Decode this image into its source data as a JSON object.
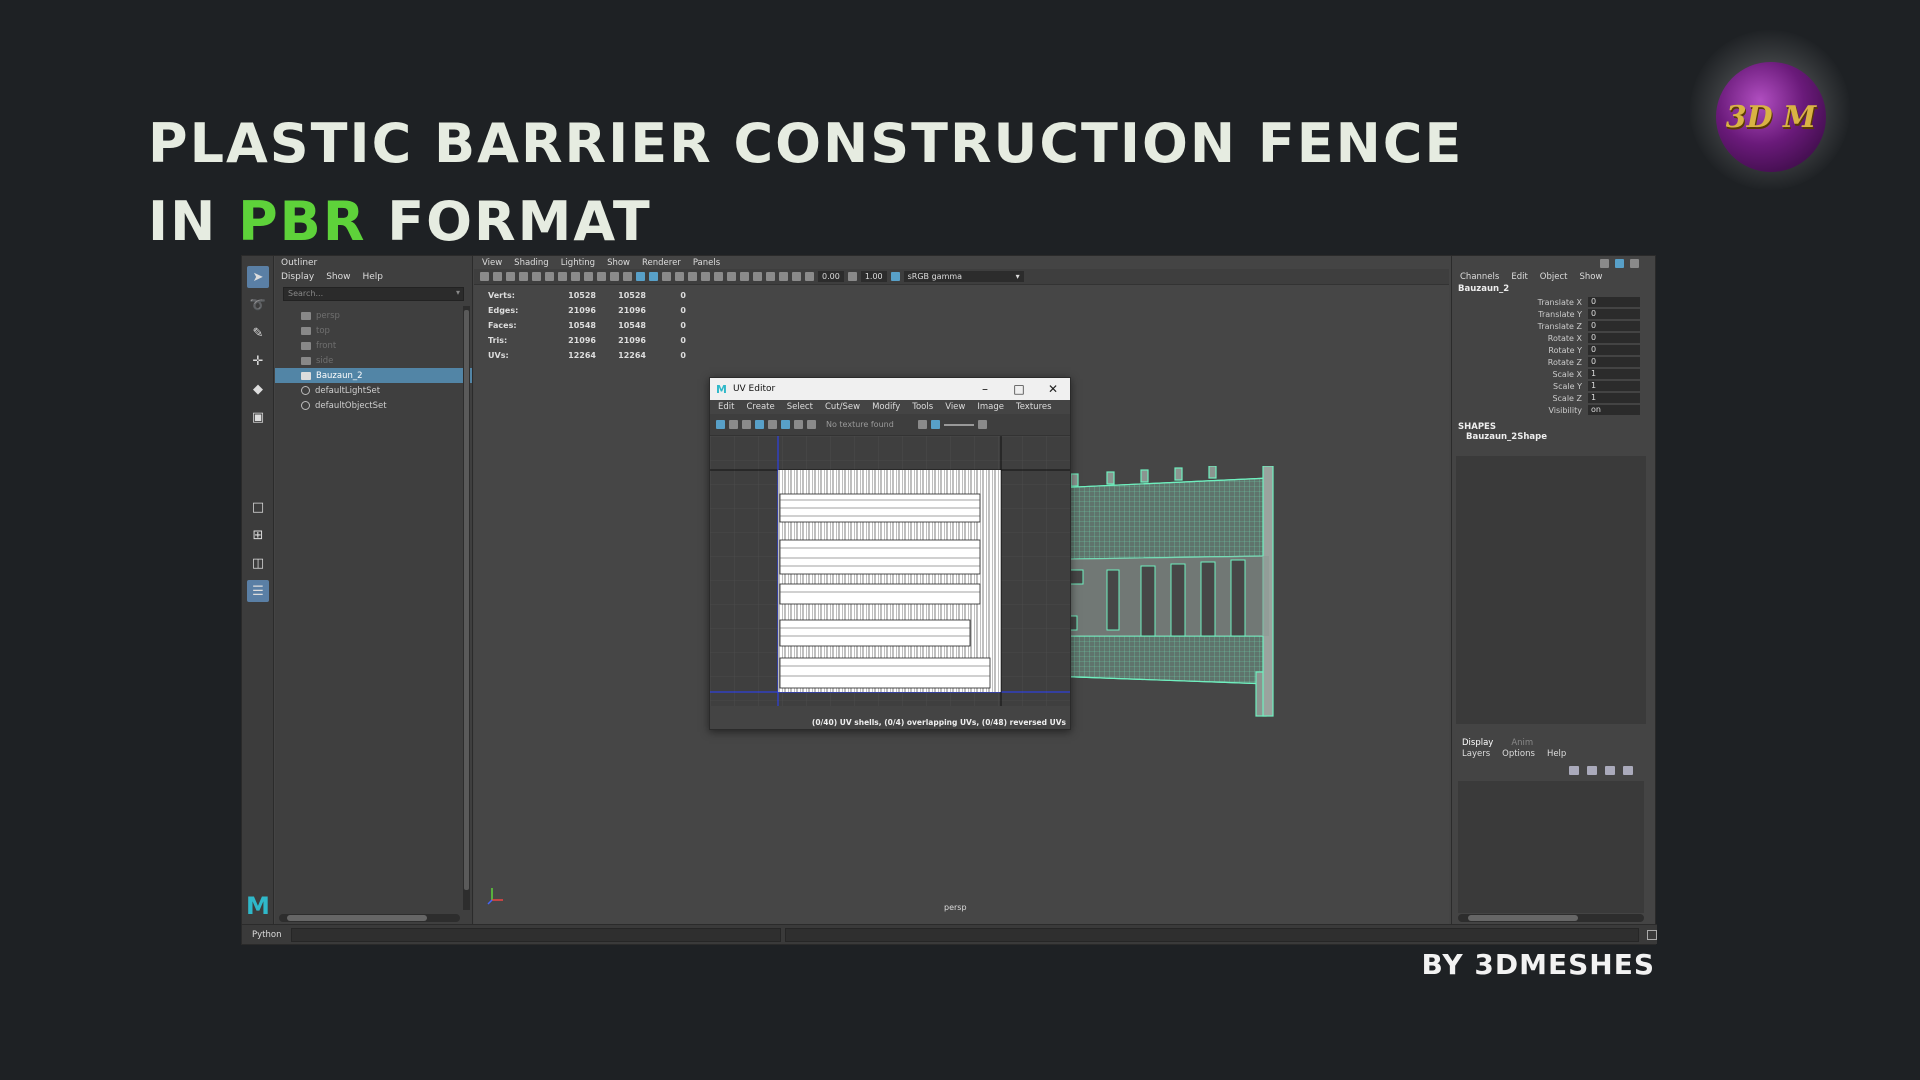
{
  "title": {
    "line1": "PLASTIC BARRIER CONSTRUCTION FENCE",
    "line2_prefix": "IN ",
    "line2_highlight": "PBR",
    "line2_suffix": " FORMAT"
  },
  "byline": "BY 3DMESHES",
  "logo_text": "3D M",
  "colors": {
    "accent_green": "#5ed23a",
    "wire_green": "#5ee8b0",
    "selection_blue": "#5285a6"
  },
  "outliner": {
    "title": "Outliner",
    "menu": [
      "Display",
      "Show",
      "Help"
    ],
    "search_placeholder": "Search...",
    "items": [
      {
        "label": "persp",
        "dim": true,
        "type": "camera"
      },
      {
        "label": "top",
        "dim": true,
        "type": "camera"
      },
      {
        "label": "front",
        "dim": true,
        "type": "camera"
      },
      {
        "label": "side",
        "dim": true,
        "type": "camera"
      },
      {
        "label": "Bauzaun_2",
        "selected": true,
        "type": "mesh"
      },
      {
        "label": "defaultLightSet",
        "type": "set"
      },
      {
        "label": "defaultObjectSet",
        "type": "set"
      }
    ]
  },
  "viewport": {
    "menu": [
      "View",
      "Shading",
      "Lighting",
      "Show",
      "Renderer",
      "Panels"
    ],
    "exposure": "0.00",
    "gamma": "1.00",
    "color_space": "sRGB gamma",
    "hud": [
      {
        "k": "Verts:",
        "a": "10528",
        "b": "10528",
        "c": "0"
      },
      {
        "k": "Edges:",
        "a": "21096",
        "b": "21096",
        "c": "0"
      },
      {
        "k": "Faces:",
        "a": "10548",
        "b": "10548",
        "c": "0"
      },
      {
        "k": "Tris:",
        "a": "21096",
        "b": "21096",
        "c": "0"
      },
      {
        "k": "UVs:",
        "a": "12264",
        "b": "12264",
        "c": "0"
      }
    ],
    "camera_label": "persp"
  },
  "uv_editor": {
    "title": "UV Editor",
    "menu": [
      "Edit",
      "Create",
      "Select",
      "Cut/Sew",
      "Modify",
      "Tools",
      "View",
      "Image",
      "Textures"
    ],
    "texture_status": "No texture found",
    "status": "(0/40) UV shells, (0/4) overlapping UVs, (0/48) reversed UVs"
  },
  "channels": {
    "menu": [
      "Channels",
      "Edit",
      "Object",
      "Show"
    ],
    "object": "Bauzaun_2",
    "attributes": [
      {
        "name": "Translate X",
        "value": "0"
      },
      {
        "name": "Translate Y",
        "value": "0"
      },
      {
        "name": "Translate Z",
        "value": "0"
      },
      {
        "name": "Rotate X",
        "value": "0"
      },
      {
        "name": "Rotate Y",
        "value": "0"
      },
      {
        "name": "Rotate Z",
        "value": "0"
      },
      {
        "name": "Scale X",
        "value": "1"
      },
      {
        "name": "Scale Y",
        "value": "1"
      },
      {
        "name": "Scale Z",
        "value": "1"
      },
      {
        "name": "Visibility",
        "value": "on"
      }
    ],
    "shapes_header": "SHAPES",
    "shape_name": "Bauzaun_2Shape"
  },
  "layers": {
    "tabs": [
      "Display",
      "Anim"
    ],
    "menu": [
      "Layers",
      "Options",
      "Help"
    ]
  },
  "statusbar": {
    "python_label": "Python"
  }
}
